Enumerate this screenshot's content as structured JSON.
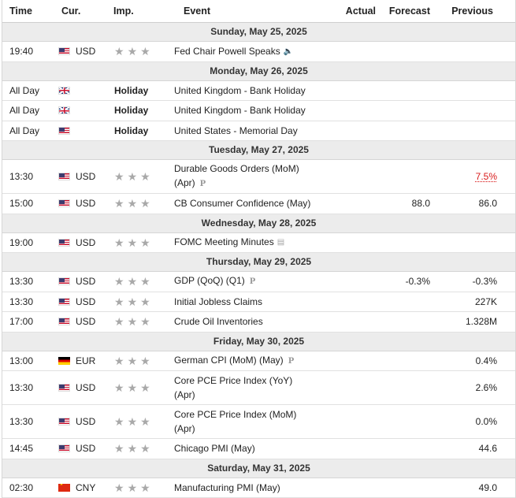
{
  "header": {
    "time": "Time",
    "currency": "Cur.",
    "importance": "Imp.",
    "event": "Event",
    "actual": "Actual",
    "forecast": "Forecast",
    "previous": "Previous"
  },
  "colors": {
    "star": "#a9a9a9",
    "negative_previous": "#d91b1b",
    "day_band": "#ececec"
  },
  "days": [
    {
      "date": "Sunday, May 25, 2025",
      "events": [
        {
          "time": "19:40",
          "flag": "us-flag-icon",
          "cur": "USD",
          "event": "Fed Chair Powell Speaks",
          "icon": "speaker-icon",
          "actual": "",
          "forecast": "",
          "previous": ""
        }
      ]
    },
    {
      "date": "Monday, May 26, 2025",
      "events": [
        {
          "time": "All Day",
          "flag": "uk-flag-icon",
          "holiday": "Holiday",
          "event": "United Kingdom - Bank Holiday"
        },
        {
          "time": "All Day",
          "flag": "uk-flag-icon",
          "holiday": "Holiday",
          "event": "United Kingdom - Bank Holiday"
        },
        {
          "time": "All Day",
          "flag": "us-flag-icon",
          "holiday": "Holiday",
          "event": "United States - Memorial Day"
        }
      ]
    },
    {
      "date": "Tuesday, May 27, 2025",
      "events": [
        {
          "time": "13:30",
          "flag": "us-flag-icon",
          "cur": "USD",
          "event_line1": "Durable Goods Orders (MoM)",
          "event_line2": "(Apr)",
          "badge": "P",
          "actual": "",
          "forecast": "",
          "previous": "7.5%"
        },
        {
          "time": "15:00",
          "flag": "us-flag-icon",
          "cur": "USD",
          "event": "CB Consumer Confidence (May)",
          "actual": "",
          "forecast": "88.0",
          "previous": "86.0"
        }
      ]
    },
    {
      "date": "Wednesday, May 28, 2025",
      "events": [
        {
          "time": "19:00",
          "flag": "us-flag-icon",
          "cur": "USD",
          "event": "FOMC Meeting Minutes",
          "icon": "document-icon",
          "actual": "",
          "forecast": "",
          "previous": ""
        }
      ]
    },
    {
      "date": "Thursday, May 29, 2025",
      "events": [
        {
          "time": "13:30",
          "flag": "us-flag-icon",
          "cur": "USD",
          "event": "GDP (QoQ) (Q1)",
          "badge": "P",
          "actual": "",
          "forecast": "-0.3%",
          "previous": "-0.3%"
        },
        {
          "time": "13:30",
          "flag": "us-flag-icon",
          "cur": "USD",
          "event": "Initial Jobless Claims",
          "actual": "",
          "forecast": "",
          "previous": "227K"
        },
        {
          "time": "17:00",
          "flag": "us-flag-icon",
          "cur": "USD",
          "event": "Crude Oil Inventories",
          "actual": "",
          "forecast": "",
          "previous": "1.328M"
        }
      ]
    },
    {
      "date": "Friday, May 30, 2025",
      "events": [
        {
          "time": "13:00",
          "flag": "de-flag-icon",
          "cur": "EUR",
          "event": "German CPI (MoM) (May)",
          "badge": "P",
          "actual": "",
          "forecast": "",
          "previous": "0.4%"
        },
        {
          "time": "13:30",
          "flag": "us-flag-icon",
          "cur": "USD",
          "event_line1": "Core PCE Price Index (YoY)",
          "event_line2": "(Apr)",
          "actual": "",
          "forecast": "",
          "previous": "2.6%"
        },
        {
          "time": "13:30",
          "flag": "us-flag-icon",
          "cur": "USD",
          "event_line1": "Core PCE Price Index (MoM)",
          "event_line2": "(Apr)",
          "actual": "",
          "forecast": "",
          "previous": "0.0%"
        },
        {
          "time": "14:45",
          "flag": "us-flag-icon",
          "cur": "USD",
          "event": "Chicago PMI (May)",
          "actual": "",
          "forecast": "",
          "previous": "44.6"
        }
      ]
    },
    {
      "date": "Saturday, May 31, 2025",
      "events": [
        {
          "time": "02:30",
          "flag": "cn-flag-icon",
          "cur": "CNY",
          "event": "Manufacturing PMI (May)",
          "actual": "",
          "forecast": "",
          "previous": "49.0"
        }
      ]
    }
  ],
  "stars_per_event": "★★★"
}
